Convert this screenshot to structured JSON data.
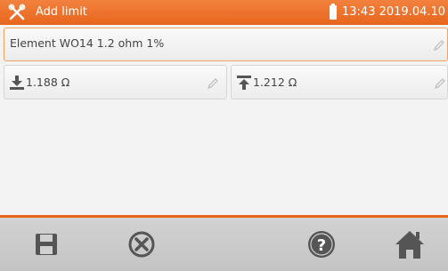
{
  "header": {
    "title": "Add limit",
    "title_icon": "tools-icon",
    "battery_icon": "battery-icon",
    "datetime": "13:43 2019.04.10"
  },
  "form": {
    "name_value": "Element WO14 1.2 ohm 1%",
    "lower_limit": "1.188 Ω",
    "upper_limit": "1.212 Ω",
    "edit_icon": "pencil-icon",
    "lower_icon": "lower-limit-arrow-icon",
    "upper_icon": "upper-limit-arrow-icon"
  },
  "footer": {
    "buttons": [
      "save-icon",
      "cancel-icon",
      "help-icon",
      "home-icon"
    ]
  },
  "colors": {
    "accent": "#e8661c",
    "icon": "#555555",
    "background": "#f3f3f3"
  }
}
